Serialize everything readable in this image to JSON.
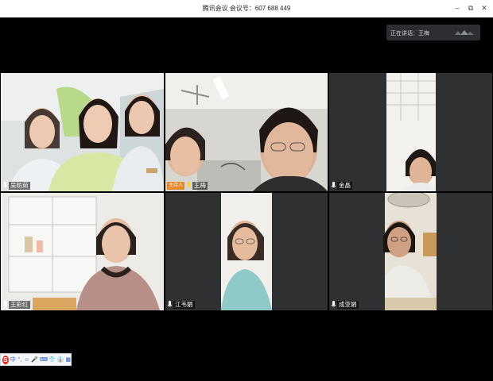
{
  "window": {
    "title": "腾讯会议  会议号：607 688 449",
    "controls": {
      "minimize": "–",
      "restore": "⧉",
      "close": "✕"
    }
  },
  "speaking": {
    "label": "正在讲话：王梅",
    "icon": "speaker-waves-icon"
  },
  "tiles": [
    {
      "name": "吴昉茹",
      "host_badge": ""
    },
    {
      "name": "王梅",
      "host_badge": "主持人"
    },
    {
      "name": "金晶",
      "host_badge": ""
    },
    {
      "name": "王彩红",
      "host_badge": ""
    },
    {
      "name": "江韦娟",
      "host_badge": ""
    },
    {
      "name": "成亚娟",
      "host_badge": ""
    }
  ],
  "ime": {
    "logo": "S",
    "items": [
      "中",
      "°,",
      "☺",
      "🎤",
      "⌨",
      "👕",
      "👔",
      "▦"
    ]
  },
  "colors": {
    "host_badge": "#e8862a",
    "tile_bg": "#2e3032",
    "stage_bg": "#000000"
  }
}
